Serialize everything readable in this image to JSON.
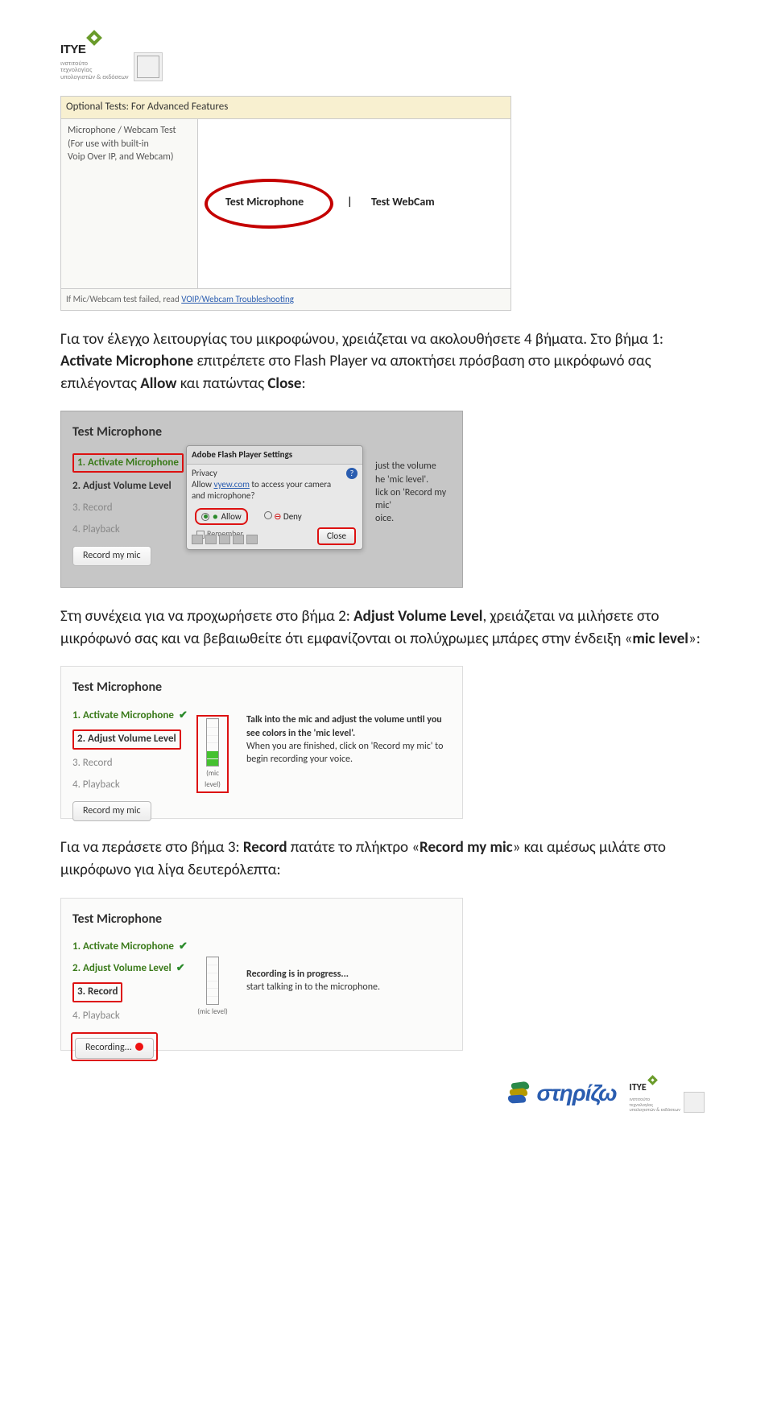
{
  "logo": {
    "brand": "ITYE",
    "sub1": "ινστιτούτο",
    "sub2": "τεχνολογίας",
    "sub3": "υπολογιστών & εκδόσεων"
  },
  "shot1": {
    "header": "Optional Tests: For Advanced Features",
    "left1": "Microphone / Webcam Test",
    "left2": "(For use with built-in",
    "left3": "Voip Over IP, and Webcam)",
    "testMic": "Test Microphone",
    "pipe": "|",
    "testCam": "Test WebCam",
    "footer_pre": "If Mic/Webcam test failed, read ",
    "footer_link": "VOIP/Webcam Troubleshooting"
  },
  "para1": {
    "t1": "Για τον έλεγχο λειτουργίας του μικροφώνου, χρειάζεται να ακολουθήσετε 4 βήματα. Στο βήμα 1: ",
    "b1": "Activate Microphone",
    "t2": " επιτρέπετε στο Flash Player να αποκτήσει πρόσβαση στο μικρόφωνό σας επιλέγοντας ",
    "b2": "Allow",
    "t3": " και πατώντας ",
    "b3": "Close",
    "t4": ":"
  },
  "tm": {
    "title": "Test Microphone",
    "s1": "1. Activate Microphone",
    "s2": "2. Adjust Volume Level",
    "s3": "3. Record",
    "s4": "4. Playback",
    "recordBtn": "Record my mic",
    "recordingBtn": "Recording...",
    "micLevel": "(mic level)"
  },
  "popup": {
    "title": "Adobe Flash Player Settings",
    "priv": "Privacy",
    "txt1": "Allow ",
    "link": "vyew.com",
    "txt2": " to access your camera and microphone?",
    "allow": "Allow",
    "deny": "Deny",
    "remember": "Remember",
    "close": "Close"
  },
  "desc1": {
    "l1": "just the volume",
    "l2": "he 'mic level'.",
    "l3": "lick on 'Record my mic'",
    "l4": "oice."
  },
  "para2": {
    "t1": "Στη συνέχεια για να προχωρήσετε στο βήμα 2: ",
    "b1": "Adjust Volume Level",
    "t2": ", χρειάζεται να μιλήσετε στο μικρόφωνό σας και να βεβαιωθείτε ότι εμφανίζονται οι πολύχρωμες μπάρες στην ένδειξη «",
    "b2": "mic level",
    "t3": "»:"
  },
  "desc2": {
    "l1": "Talk into the mic and adjust the volume until you see colors in the 'mic level'.",
    "l2": "When you are finished, click on 'Record my mic' to begin recording your voice."
  },
  "para3": {
    "t1": "Για να περάσετε στο βήμα 3: ",
    "b1": "Record",
    "t2": " πατάτε το πλήκτρο «",
    "b2": "Record my mic",
    "t3": "» και αμέσως μιλάτε στο μικρόφωνο για λίγα δευτερόλεπτα:"
  },
  "desc3": {
    "l1": "Recording is in progress...",
    "l2": "start talking in to the microphone."
  },
  "footer": {
    "stir": "στηρίζω"
  }
}
